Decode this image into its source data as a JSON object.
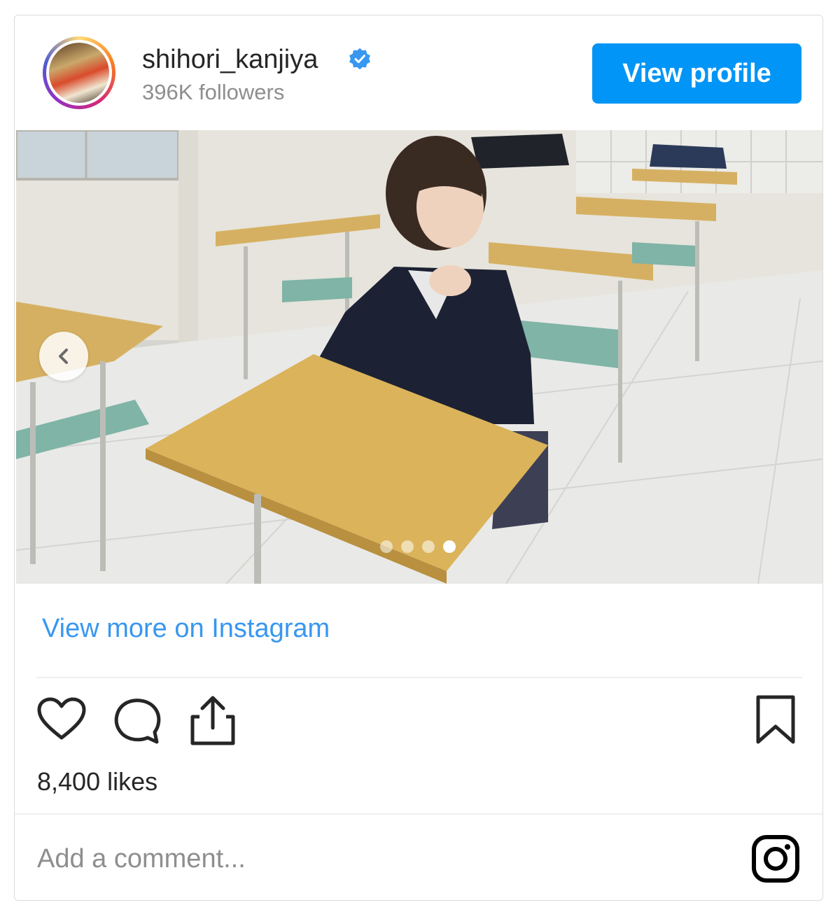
{
  "header": {
    "username": "shihori_kanjiya",
    "followers": "396K followers",
    "view_profile_label": "View profile"
  },
  "media": {
    "current_slide": 4,
    "total_slides": 4
  },
  "links": {
    "view_more": "View more on Instagram"
  },
  "stats": {
    "likes": "8,400 likes"
  },
  "comment": {
    "placeholder": "Add a comment..."
  },
  "colors": {
    "accent": "#0095f6",
    "link": "#3897f0",
    "muted": "#8e8e8e"
  },
  "icons": [
    "verified-badge-icon",
    "chevron-left-icon",
    "heart-icon",
    "comment-icon",
    "share-icon",
    "bookmark-icon",
    "instagram-logo-icon"
  ]
}
